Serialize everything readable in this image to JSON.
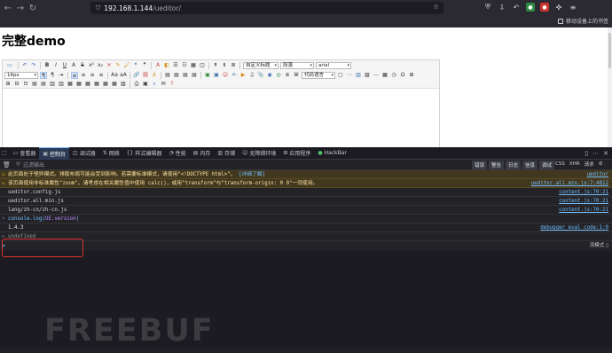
{
  "browser": {
    "url_host": "192.168.1.144",
    "url_path": "/ueditor/",
    "mobile_bookmarks_label": "移动设备上的书签"
  },
  "page": {
    "title": "完整demo"
  },
  "editor": {
    "combo_style": "自定义标题",
    "combo_paragraph": "段落",
    "combo_font": "arial",
    "combo_size": "16px",
    "code_language": "代码语言"
  },
  "devtools": {
    "tabs": [
      {
        "label": "查看器",
        "icon": "inspector-icon"
      },
      {
        "label": "控制台",
        "icon": "console-icon"
      },
      {
        "label": "调试器",
        "icon": "debugger-icon"
      },
      {
        "label": "网络",
        "icon": "network-icon"
      },
      {
        "label": "样式编辑器",
        "icon": "style-icon"
      },
      {
        "label": "性能",
        "icon": "performance-icon"
      },
      {
        "label": "内存",
        "icon": "memory-icon"
      },
      {
        "label": "存储",
        "icon": "storage-icon"
      },
      {
        "label": "无障碍环境",
        "icon": "accessibility-icon"
      },
      {
        "label": "应用程序",
        "icon": "application-icon"
      },
      {
        "label": "HackBar",
        "icon": "hackbar-icon"
      }
    ],
    "filter_placeholder": "过滤输出",
    "levels": [
      "错误",
      "警告",
      "日志",
      "信息",
      "调试"
    ],
    "filter_extra": [
      "CSS",
      "XHR",
      "请求"
    ],
    "messages": [
      {
        "type": "warn",
        "text": "此页面处于怪异模式。排版布局可能会受到影响。若需要标准模式，请使用\"<!DOCTYPE html>\"。",
        "link": "[详细了解]",
        "source": "ueditor"
      },
      {
        "type": "warn",
        "text": "该页面使用非标准属性\"zoom\"。请考虑在相关属性值中使用 calc()，或用\"transform\"与\"transform-origin: 0 0\"一同使用。",
        "source": "ueditor.all.min.js:7:4812"
      },
      {
        "type": "log",
        "text": "ueditor.config.js",
        "source": "content.js:70:21"
      },
      {
        "type": "log",
        "text": "ueditor.all.min.js",
        "source": "content.js:70:21"
      },
      {
        "type": "log",
        "text": "lang/zh-cn/zh-cn.js",
        "source": "content.js:70:21"
      }
    ],
    "input_command_prefix": "console.log(",
    "input_command_prop": "UE.version",
    "input_command_suffix": ")",
    "result_value": "1.4.3",
    "result_source": "debugger eval code:1:9",
    "undefined_text": "undefined",
    "prompt_symbol": "»",
    "multiline_label": "流模式"
  },
  "watermark": "FREEBUF"
}
